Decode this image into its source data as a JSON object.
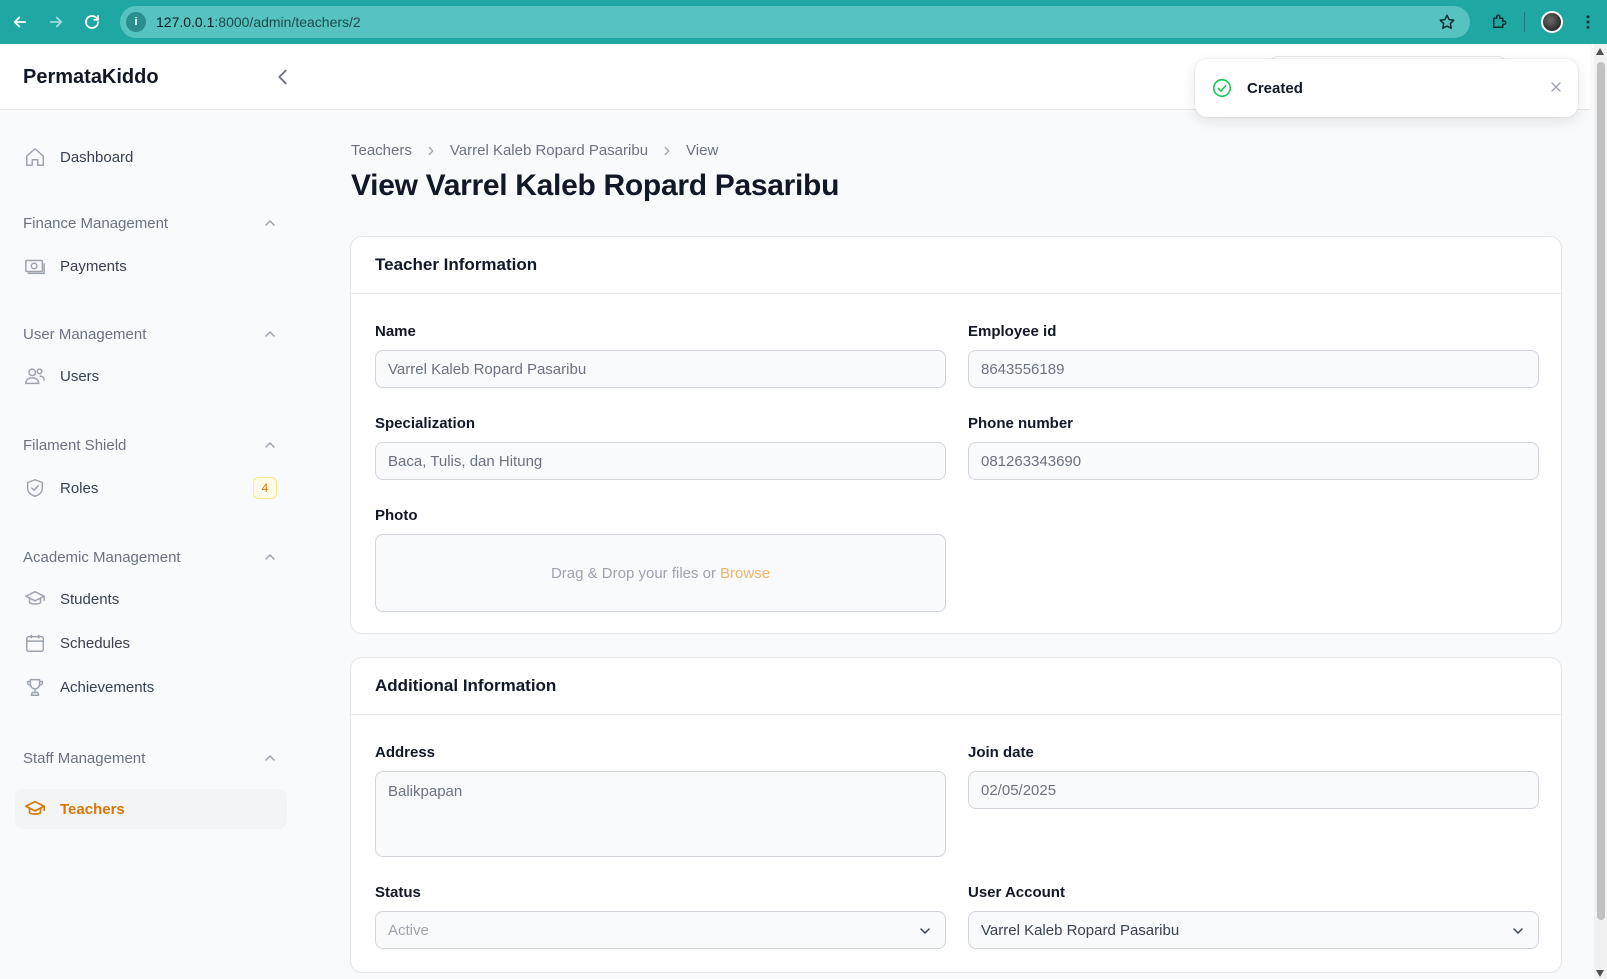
{
  "browser": {
    "url_host": "127.0.0.1",
    "url_path": ":8000/admin/teachers/2"
  },
  "app": {
    "brand": "PermataKiddo"
  },
  "sidebar": {
    "dashboard": "Dashboard",
    "groups": {
      "finance": "Finance Management",
      "user": "User Management",
      "shield": "Filament Shield",
      "academic": "Academic Management",
      "staff": "Staff Management"
    },
    "items": {
      "payments": "Payments",
      "users": "Users",
      "roles": "Roles",
      "roles_badge": "4",
      "students": "Students",
      "schedules": "Schedules",
      "achievements": "Achievements",
      "teachers": "Teachers"
    }
  },
  "breadcrumb": {
    "level1": "Teachers",
    "level2": "Varrel Kaleb Ropard Pasaribu",
    "level3": "View"
  },
  "page": {
    "title": "View Varrel Kaleb Ropard Pasaribu"
  },
  "teacher_info": {
    "heading": "Teacher Information",
    "name_label": "Name",
    "name_value": "Varrel Kaleb Ropard Pasaribu",
    "employee_id_label": "Employee id",
    "employee_id_value": "8643556189",
    "specialization_label": "Specialization",
    "specialization_value": "Baca, Tulis, dan Hitung",
    "phone_label": "Phone number",
    "phone_value": "081263343690",
    "photo_label": "Photo",
    "dropzone_text": "Drag & Drop your files or",
    "dropzone_browse": "Browse"
  },
  "additional_info": {
    "heading": "Additional Information",
    "address_label": "Address",
    "address_value": "Balikpapan",
    "join_date_label": "Join date",
    "join_date_value": "02/05/2025",
    "status_label": "Status",
    "status_value": "Active",
    "user_account_label": "User Account",
    "user_account_value": "Varrel Kaleb Ropard Pasaribu"
  },
  "toast": {
    "message": "Created"
  },
  "colors": {
    "accent": "#d97706",
    "browser_bar": "#1fa7a3",
    "success": "#22c55e"
  }
}
